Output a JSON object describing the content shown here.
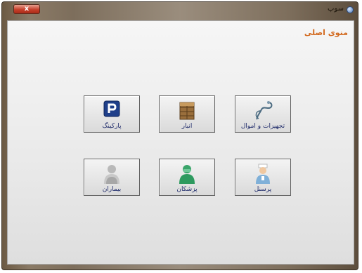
{
  "window": {
    "title": "سوپ",
    "close_label": "x"
  },
  "page": {
    "title": "منوی اصلی"
  },
  "tiles": [
    {
      "label": "تجهیزات و اموال",
      "icon": "stethoscope-icon"
    },
    {
      "label": "انبار",
      "icon": "warehouse-boxes-icon"
    },
    {
      "label": "پارکینگ",
      "icon": "parking-icon"
    },
    {
      "label": "پرسنل",
      "icon": "nurse-icon"
    },
    {
      "label": "پزشکان",
      "icon": "surgeon-icon"
    },
    {
      "label": "بیماران",
      "icon": "patient-icon"
    }
  ],
  "colors": {
    "page_title": "#d2691e",
    "tile_label": "#1e2a6a",
    "close_button": "#c7402b"
  }
}
